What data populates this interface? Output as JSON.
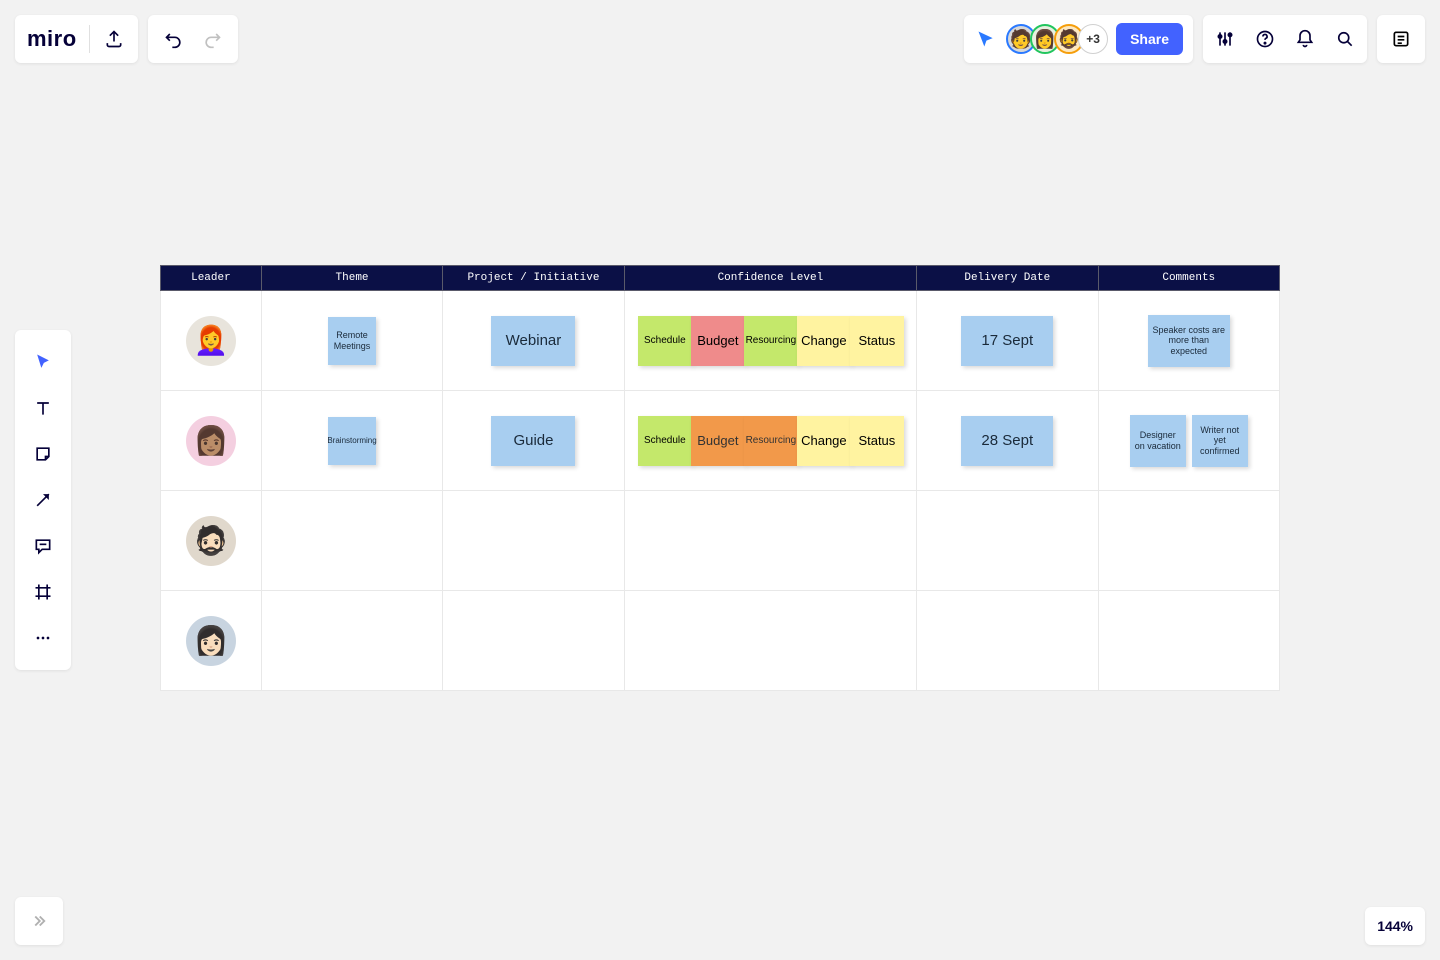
{
  "app": {
    "logo": "miro"
  },
  "presence": {
    "extra": "+3",
    "share": "Share"
  },
  "zoom": "144%",
  "table": {
    "headers": {
      "leader": "Leader",
      "theme": "Theme",
      "project": "Project / Initiative",
      "confidence": "Confidence Level",
      "delivery": "Delivery Date",
      "comments": "Comments"
    },
    "rows": [
      {
        "theme": "Remote Meetings",
        "project": "Webinar",
        "schedule": "Schedule",
        "budget": "Budget",
        "budget_color": "red",
        "resourcing": "Resourcing",
        "change": "Change",
        "status": "Status",
        "date": "17 Sept",
        "comments": [
          "Speaker costs are more than expected"
        ]
      },
      {
        "theme": "Brainstorming",
        "project": "Guide",
        "schedule": "Schedule",
        "budget": "Budget",
        "budget_color": "orange",
        "resourcing": "Resourcing",
        "change": "Change",
        "status": "Status",
        "date": "28 Sept",
        "comments": [
          "Designer on vacation",
          "Writer not yet confirmed"
        ]
      },
      {
        "empty": true
      },
      {
        "empty": true
      }
    ]
  }
}
